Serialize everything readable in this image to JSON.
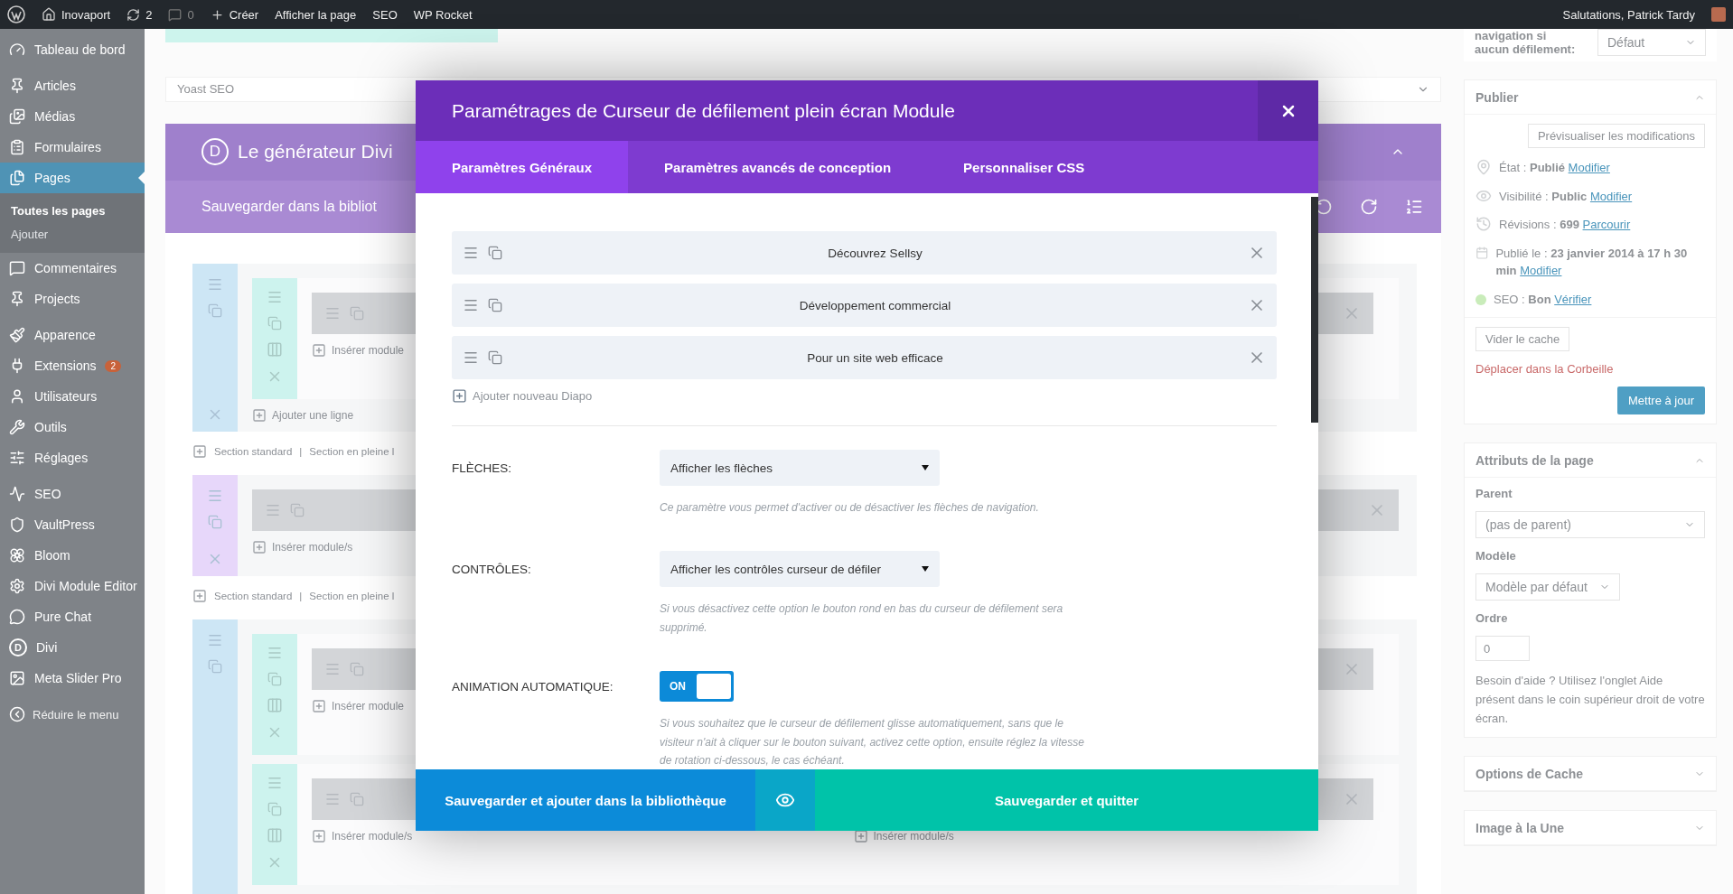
{
  "admin_bar": {
    "site": "Inovaport",
    "updates": "2",
    "comments": "0",
    "create": "Créer",
    "links": [
      "Afficher la page",
      "SEO",
      "WP Rocket"
    ],
    "greeting": "Salutations, Patrick Tardy"
  },
  "menu": {
    "groups": [
      {
        "items": [
          {
            "label": "Tableau de bord",
            "selected": false
          }
        ]
      },
      {
        "items": [
          {
            "label": "Articles",
            "selected": false
          },
          {
            "label": "Médias",
            "selected": false
          },
          {
            "label": "Formulaires",
            "selected": false
          },
          {
            "label": "Pages",
            "selected": true,
            "children": [
              {
                "label": "Toutes les pages",
                "selected": true
              },
              {
                "label": "Ajouter",
                "selected": false
              }
            ]
          },
          {
            "label": "Commentaires",
            "selected": false
          },
          {
            "label": "Projects",
            "selected": false
          }
        ]
      },
      {
        "items": [
          {
            "label": "Apparence",
            "selected": false
          },
          {
            "label": "Extensions",
            "selected": false,
            "badge": "2"
          },
          {
            "label": "Utilisateurs",
            "selected": false
          },
          {
            "label": "Outils",
            "selected": false
          },
          {
            "label": "Réglages",
            "selected": false
          }
        ]
      },
      {
        "items": [
          {
            "label": "SEO",
            "selected": false
          },
          {
            "label": "VaultPress",
            "selected": false
          },
          {
            "label": "Bloom",
            "selected": false
          },
          {
            "label": "Divi Module Editor",
            "selected": false
          },
          {
            "label": "Pure Chat",
            "selected": false
          },
          {
            "label": "Divi",
            "selected": false,
            "logo_letter": "D"
          },
          {
            "label": "Meta Slider Pro",
            "selected": false
          }
        ]
      }
    ],
    "collapse": "Réduire le menu"
  },
  "builder": {
    "yoast": "Yoast SEO",
    "logo_letter": "D",
    "title": "Le générateur Divi",
    "save_library": "Sauvegarder dans la bibliot",
    "link_separator": "|",
    "sections": [
      {
        "kind": "standard",
        "rows": [
          {
            "columns": [
              {
                "insert": "Insérer module"
              }
            ]
          }
        ],
        "add_row": "Ajouter une ligne",
        "links": [
          "Section standard",
          "Section en pleine l"
        ]
      },
      {
        "kind": "fullwidth",
        "modules": [
          {
            "insert": "Insérer module/s"
          }
        ],
        "links": [
          "Section standard",
          "Section en pleine l"
        ]
      },
      {
        "kind": "standard",
        "rows": [
          {
            "columns": [
              {
                "insert": "Insérer module"
              }
            ]
          },
          {
            "columns": [
              {
                "insert": "Insérer module/s"
              },
              {
                "insert": "Insérer module/s"
              }
            ]
          }
        ]
      }
    ]
  },
  "side_panels": {
    "navigation": {
      "label": "navigation si aucun défilement:",
      "select": "Défaut"
    },
    "publish": {
      "title": "Publier",
      "preview": "Prévisualiser les modifications",
      "rows": [
        {
          "kind": "pin",
          "text": "État : **Publié**",
          "link": "Modifier"
        },
        {
          "kind": "eye",
          "text": "Visibilité : **Public**",
          "link": "Modifier"
        },
        {
          "kind": "history",
          "text": "Révisions : **699**",
          "link": "Parcourir"
        },
        {
          "kind": "calendar",
          "text": "Publié le : **23 janvier 2014 à 17 h 30 min**",
          "link": "Modifier"
        },
        {
          "kind": "status",
          "color": "#c9ecba",
          "text": "SEO : **Bon**",
          "link": "Vérifier"
        }
      ],
      "clear_cache": "Vider le cache",
      "trash": "Déplacer dans la Corbeille",
      "update": "Mettre à jour"
    },
    "attributes": {
      "title": "Attributs de la page",
      "parent_label": "Parent",
      "parent": "(pas de parent)",
      "template_label": "Modèle",
      "template": "Modèle par défaut",
      "order_label": "Ordre",
      "order": "0",
      "help": "Besoin d'aide ? Utilisez l'onglet Aide présent dans le coin supérieur droit de votre écran."
    },
    "collapsed": [
      {
        "title": "Options de Cache"
      },
      {
        "title": "Image à la Une"
      }
    ]
  },
  "modal": {
    "title": "Paramétrages de Curseur de défilement plein écran Module",
    "tabs": [
      {
        "label": "Paramètres Généraux",
        "selected": true
      },
      {
        "label": "Paramètres avancés de conception",
        "selected": false
      },
      {
        "label": "Personnaliser CSS",
        "selected": false
      }
    ],
    "slides": [
      {
        "title": "Découvrez Sellsy"
      },
      {
        "title": "Développement commercial"
      },
      {
        "title": "Pour un site web efficace"
      }
    ],
    "add_slide": "Ajouter nouveau Diapo",
    "settings": [
      {
        "kind": "select",
        "label": "FLÈCHES:",
        "value": "Afficher les flèches",
        "help": "Ce paramètre vous permet d'activer ou de désactiver les flèches de navigation."
      },
      {
        "kind": "select",
        "label": "CONTRÔLES:",
        "value": "Afficher les contrôles curseur de défiler",
        "help": "Si vous désactivez cette option le bouton rond en bas du curseur de défilement sera supprimé."
      },
      {
        "kind": "toggle",
        "label": "ANIMATION AUTOMATIQUE:",
        "on": true,
        "on_label": "ON",
        "help": "Si vous souhaitez que le curseur de défilement glisse automatiquement, sans que le visiteur n'ait à cliquer sur le bouton suivant, activez cette option, ensuite réglez la vitesse de rotation ci-dessous, le cas échéant."
      }
    ],
    "save_library": "Sauvegarder et ajouter dans la bibliothèque",
    "save_quit": "Sauvegarder et quitter"
  }
}
